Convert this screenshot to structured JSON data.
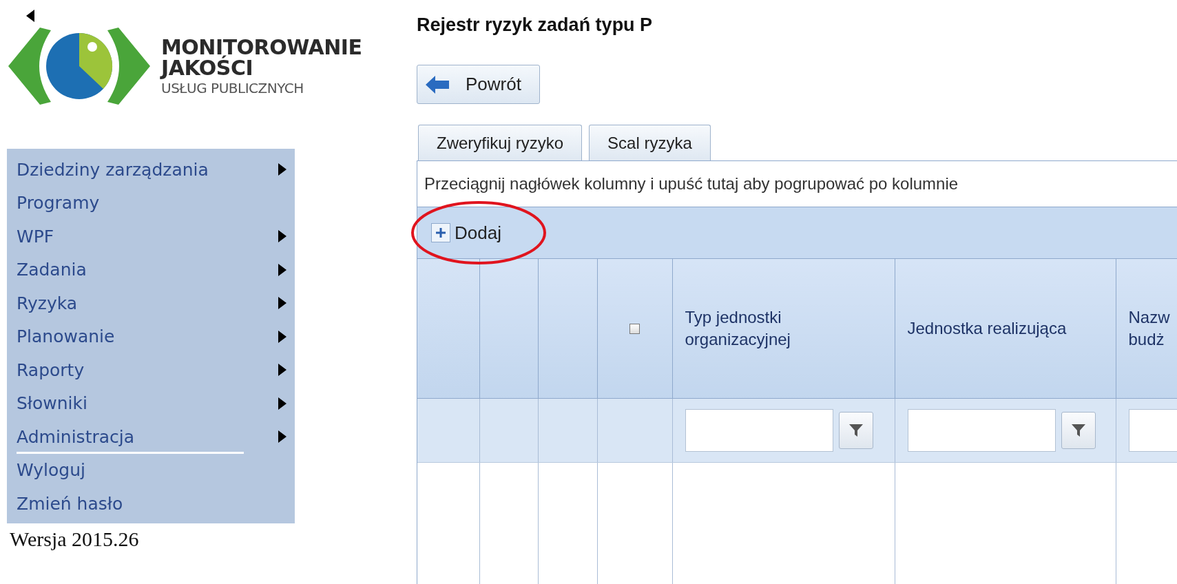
{
  "logo": {
    "line_1": "MONITOROWANIE",
    "line_2": "JAKOŚCI",
    "line_3": "USŁUG PUBLICZNYCH"
  },
  "menu": [
    {
      "label": "Dziedziny zarządzania",
      "has_submenu": true,
      "divider_below": false
    },
    {
      "label": "Programy",
      "has_submenu": false,
      "divider_below": false
    },
    {
      "label": "WPF",
      "has_submenu": true,
      "divider_below": false
    },
    {
      "label": "Zadania",
      "has_submenu": true,
      "divider_below": false
    },
    {
      "label": "Ryzyka",
      "has_submenu": true,
      "divider_below": false
    },
    {
      "label": "Planowanie",
      "has_submenu": true,
      "divider_below": false
    },
    {
      "label": "Raporty",
      "has_submenu": true,
      "divider_below": false
    },
    {
      "label": "Słowniki",
      "has_submenu": true,
      "divider_below": false
    },
    {
      "label": "Administracja",
      "has_submenu": true,
      "divider_below": true
    },
    {
      "label": "Wyloguj",
      "has_submenu": false,
      "divider_below": false
    },
    {
      "label": "Zmień hasło",
      "has_submenu": false,
      "divider_below": false
    }
  ],
  "version": "Wersja 2015.26",
  "page_title": "Rejestr ryzyk zadań typu P",
  "back_button": "Powrót",
  "tabs": [
    {
      "label": "Zweryfikuj ryzyko"
    },
    {
      "label": "Scal ryzyka"
    }
  ],
  "grid": {
    "group_panel_hint": "Przeciągnij nagłówek kolumny i upuść tutaj aby pogrupować po kolumnie",
    "add_button": "Dodaj",
    "highlight_circle": true,
    "columns": [
      {
        "kind": "blank",
        "filter": false
      },
      {
        "kind": "blank",
        "filter": false
      },
      {
        "kind": "blank",
        "filter": false
      },
      {
        "kind": "checkbox",
        "checked": false,
        "filter": false
      },
      {
        "kind": "text",
        "label": "Typ jednostki organizacyjnej",
        "filter": true,
        "filter_button": true
      },
      {
        "kind": "text",
        "label": "Jednostka realizująca",
        "filter": true,
        "filter_button": true
      },
      {
        "kind": "text",
        "label": "Nazw budż",
        "filter": true,
        "filter_button": false
      }
    ]
  }
}
